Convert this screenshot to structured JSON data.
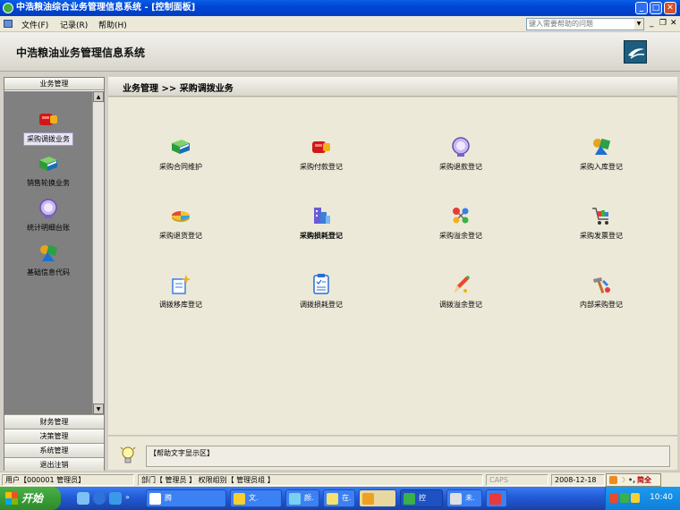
{
  "window": {
    "title": "中浩粮油综合业务管理信息系统 - [控制面板]"
  },
  "menu": {
    "items": [
      "文件(F)",
      "记录(R)",
      "帮助(H)"
    ],
    "help_placeholder": "键入需要帮助的问题"
  },
  "header": {
    "title": "中浩粮油业务管理信息系统"
  },
  "sidebar": {
    "active_group": "业务管理",
    "items": [
      {
        "label": "采购调拨业务",
        "icon": "red-package-icon",
        "selected": true
      },
      {
        "label": "销售轮换业务",
        "icon": "green-book-icon",
        "selected": false
      },
      {
        "label": "统计明细台账",
        "icon": "purple-clock-icon",
        "selected": false
      },
      {
        "label": "基础信息代码",
        "icon": "shapes-icon",
        "selected": false
      }
    ],
    "bottom_groups": [
      "财务管理",
      "决策管理",
      "系统管理",
      "退出注销"
    ]
  },
  "main": {
    "breadcrumb": "业务管理 >> 采购调拨业务",
    "tiles": [
      {
        "label": "采购合同维护",
        "icon": "green-book-icon",
        "bold": false
      },
      {
        "label": "采购付款登记",
        "icon": "red-package-icon",
        "bold": false
      },
      {
        "label": "采购退款登记",
        "icon": "purple-clock-icon",
        "bold": false
      },
      {
        "label": "采购入库登记",
        "icon": "shapes-icon",
        "bold": false
      },
      {
        "label": "采购退货登记",
        "icon": "pie-chart-icon",
        "bold": false
      },
      {
        "label": "采购损耗登记",
        "icon": "buildings-icon",
        "bold": true
      },
      {
        "label": "采购溢余登记",
        "icon": "network-icon",
        "bold": false
      },
      {
        "label": "采购发票登记",
        "icon": "shopping-cart-icon",
        "bold": false
      },
      {
        "label": "调拨移库登记",
        "icon": "starburst-note-icon",
        "bold": false
      },
      {
        "label": "调拨损耗登记",
        "icon": "checklist-icon",
        "bold": false
      },
      {
        "label": "调拨溢余登记",
        "icon": "pencil-icon",
        "bold": false
      },
      {
        "label": "内部采购登记",
        "icon": "tools-icon",
        "bold": false
      }
    ]
  },
  "help_area": {
    "text": "【帮助文字显示区】"
  },
  "statusbar": {
    "user": "用户【000001 管理员】",
    "dept": "部门【 管理员 】 权限组别【 管理员组 】",
    "caps": "CAPS",
    "date": "2008-12-18"
  },
  "ime": {
    "label": "简全"
  },
  "taskbar": {
    "start_label": "开始",
    "tasks": [
      "腾",
      "文.",
      "颜.",
      "在.",
      "控",
      "未.",
      ""
    ],
    "clock": "10:40"
  }
}
